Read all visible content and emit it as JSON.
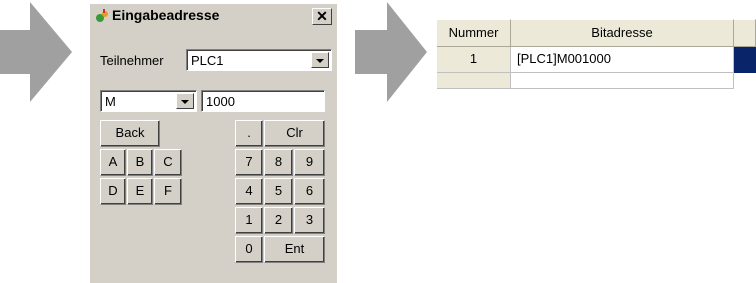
{
  "dialog": {
    "title": "Eingabeadresse",
    "close_label": "✕",
    "participant_label": "Teilnehmer",
    "participant_value": "PLC1",
    "device_type_value": "M",
    "address_value": "1000",
    "keys": {
      "back": "Back",
      "dot": ".",
      "clr": "Clr",
      "a": "A",
      "b": "B",
      "c": "C",
      "d": "D",
      "e": "E",
      "f": "F",
      "n7": "7",
      "n8": "8",
      "n9": "9",
      "n4": "4",
      "n5": "5",
      "n6": "6",
      "n1": "1",
      "n2": "2",
      "n3": "3",
      "n0": "0",
      "ent": "Ent"
    }
  },
  "table": {
    "headers": [
      "Nummer",
      "Bitadresse"
    ],
    "rows": [
      {
        "number": "1",
        "address": "[PLC1]M001000"
      }
    ],
    "selection_color": "#0a246a"
  },
  "colors": {
    "arrow": "#a0a0a0",
    "dialog_bg": "#d4d0c8"
  }
}
